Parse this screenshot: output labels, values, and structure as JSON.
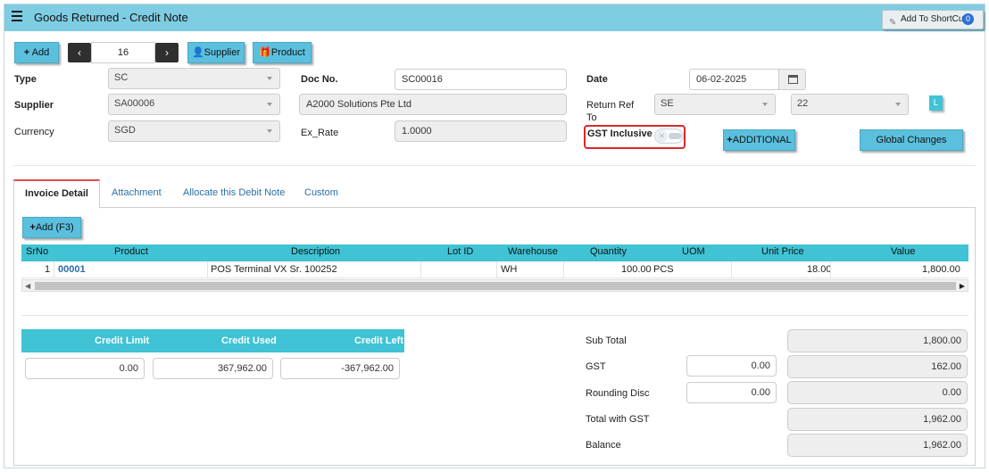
{
  "header": {
    "title": "Goods Returned - Credit Note",
    "shortcut_label": "Add To ShortCut",
    "shortcut_count": "0"
  },
  "toolbar": {
    "add_label": "Add",
    "record_number": "16",
    "supplier_label": "Supplier",
    "product_label": "Product"
  },
  "form": {
    "type_label": "Type",
    "type_value": "SC",
    "supplier_label": "Supplier",
    "supplier_value": "SA00006",
    "currency_label": "Currency",
    "currency_value": "SGD",
    "doc_no_label": "Doc No.",
    "doc_no_value": "SC00016",
    "supplier_name_value": "A2000 Solutions Pte Ltd",
    "ex_rate_label": "Ex_Rate",
    "ex_rate_value": "1.0000",
    "date_label": "Date",
    "date_value": "06-02-2025",
    "return_ref_label_1": "Return Ref",
    "return_ref_label_2": "To",
    "return_ref_type": "SE",
    "return_ref_no": "22",
    "l_badge": "L",
    "gst_inclusive_label": "GST Inclusive",
    "gst_inclusive_on": false,
    "additional_label": "ADDITIONAL",
    "global_changes_label": "Global Changes"
  },
  "tabs": [
    {
      "label": "Invoice Detail",
      "active": true
    },
    {
      "label": "Attachment"
    },
    {
      "label": "Allocate this Debit Note"
    },
    {
      "label": "Custom"
    }
  ],
  "detail": {
    "add_line_label": "Add (F3)",
    "columns": [
      "SrNo",
      "Product",
      "Description",
      "Lot ID",
      "Warehouse",
      "Quantity",
      "UOM",
      "Unit Price",
      "Value"
    ],
    "rows": [
      {
        "srno": "1",
        "product": "00001",
        "description": "POS Terminal VX Sr. 100252",
        "lot_id": "",
        "warehouse": "WH",
        "quantity": "100.00",
        "uom": "PCS",
        "unit_price": "18.00",
        "value": "1,800.00"
      }
    ]
  },
  "credit": {
    "limit_label": "Credit Limit",
    "used_label": "Credit Used",
    "left_label": "Credit Left",
    "limit_value": "0.00",
    "used_value": "367,962.00",
    "left_value": "-367,962.00"
  },
  "totals": {
    "sub_total_label": "Sub Total",
    "sub_total_value": "1,800.00",
    "gst_label": "GST",
    "gst_rate_input": "0.00",
    "gst_value": "162.00",
    "rounding_label": "Rounding Disc",
    "rounding_input": "0.00",
    "rounding_value": "0.00",
    "total_with_gst_label": "Total with GST",
    "total_with_gst_value": "1,962.00",
    "balance_label": "Balance",
    "balance_value": "1,962.00"
  },
  "colors": {
    "header_bg": "#7ecde3",
    "accent": "#5bc0de",
    "grid_header": "#3fc3d5",
    "gst_highlight": "#d52b2b"
  }
}
